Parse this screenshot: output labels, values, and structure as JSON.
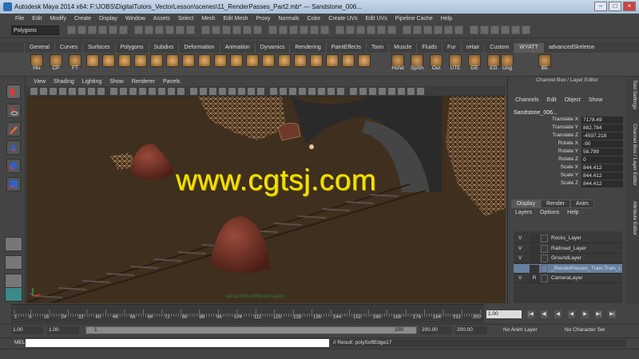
{
  "window": {
    "title": "Autodesk Maya 2014 x64: F:\\JOBS\\DigitalTutors_VectorLesson\\scenes\\11_RenderPasses_Part2.mb*    ---    Sandstone_006...",
    "btn_min": "–",
    "btn_max": "□",
    "btn_close": "×"
  },
  "menubar": [
    "File",
    "Edit",
    "Modify",
    "Create",
    "Display",
    "Window",
    "Assets",
    "Select",
    "Mesh",
    "Edit Mesh",
    "Proxy",
    "Normals",
    "Color",
    "Create UVs",
    "Edit UVs",
    "Pipeline Cache",
    "Help"
  ],
  "status_line": {
    "mode": "Polygons"
  },
  "shelf": {
    "tabs": [
      "General",
      "Curves",
      "Surfaces",
      "Polygons",
      "Subdivs",
      "Deformation",
      "Animation",
      "Dynamics",
      "Rendering",
      "PaintEffects",
      "Toon",
      "Muscle",
      "Fluids",
      "Fur",
      "nHair",
      "Custom",
      "WYATT",
      "advancedSkeleton"
    ],
    "active_tab": "WYATT",
    "buttons": [
      "His",
      "CP",
      "FT",
      "Hshd",
      "SpSh",
      "Out",
      "UTE",
      "GE",
      "EG",
      "Ung",
      "BE"
    ]
  },
  "panel": {
    "menu": [
      "View",
      "Shading",
      "Lighting",
      "Show",
      "Renderer",
      "Panels"
    ],
    "hud_label": "persp (defaultRenderLayer)",
    "watermark": "www.cgtsj.com"
  },
  "channel_box": {
    "header": "Channel Box / Layer Editor",
    "menu": [
      "Channels",
      "Edit",
      "Object",
      "Show"
    ],
    "object_name": "Sandstone_006...",
    "attributes": [
      {
        "label": "Translate X",
        "value": "7178.49"
      },
      {
        "label": "Translate Y",
        "value": "882.784"
      },
      {
        "label": "Translate Z",
        "value": "-4597.218"
      },
      {
        "label": "Rotate X",
        "value": "-90"
      },
      {
        "label": "Rotate Y",
        "value": "58.799"
      },
      {
        "label": "Rotate Z",
        "value": "0"
      },
      {
        "label": "Scale X",
        "value": "844.412"
      },
      {
        "label": "Scale Y",
        "value": "844.412"
      },
      {
        "label": "Scale Z",
        "value": "844.412"
      }
    ],
    "side_tabs": [
      "Tool Settings",
      "Channel Box / Layer Editor",
      "Attribute Editor"
    ]
  },
  "layer_editor": {
    "tabs": [
      "Display",
      "Render",
      "Anim"
    ],
    "active_tab": "Display",
    "menu": [
      "Layers",
      "Options",
      "Help"
    ],
    "layers": [
      {
        "vis": "V",
        "ref": "",
        "name": "Rocks_Layer",
        "selected": false
      },
      {
        "vis": "V",
        "ref": "",
        "name": "Railroad_Layer",
        "selected": false
      },
      {
        "vis": "V",
        "ref": "",
        "name": "GroundLayer",
        "selected": false
      },
      {
        "vis": "",
        "ref": "",
        "name": "_RenderPasses_Train:Train_La",
        "selected": true
      },
      {
        "vis": "V",
        "ref": "R",
        "name": "CameraLayer",
        "selected": false
      }
    ]
  },
  "timeline": {
    "ticks": [
      "1",
      "8",
      "16",
      "24",
      "32",
      "40",
      "48",
      "56",
      "64",
      "72",
      "80",
      "88",
      "96",
      "104",
      "112",
      "120",
      "128",
      "136",
      "144",
      "152",
      "160",
      "168",
      "176",
      "184",
      "192",
      "200"
    ],
    "current_frame": "1.00",
    "playback_buttons": [
      "|◀",
      "◀|",
      "◀",
      "◀",
      "▶",
      "▶|",
      "▶|"
    ]
  },
  "range": {
    "start_time": "1.00",
    "playback_start": "1.00",
    "slider_start": "1",
    "slider_end": "200",
    "playback_end": "200.00",
    "end_time": "200.00",
    "anim_layer": "No Anim Layer",
    "character_set": "No Character Set"
  },
  "command_line": {
    "label": "MEL",
    "result": "// Result: polySoftEdge17"
  }
}
